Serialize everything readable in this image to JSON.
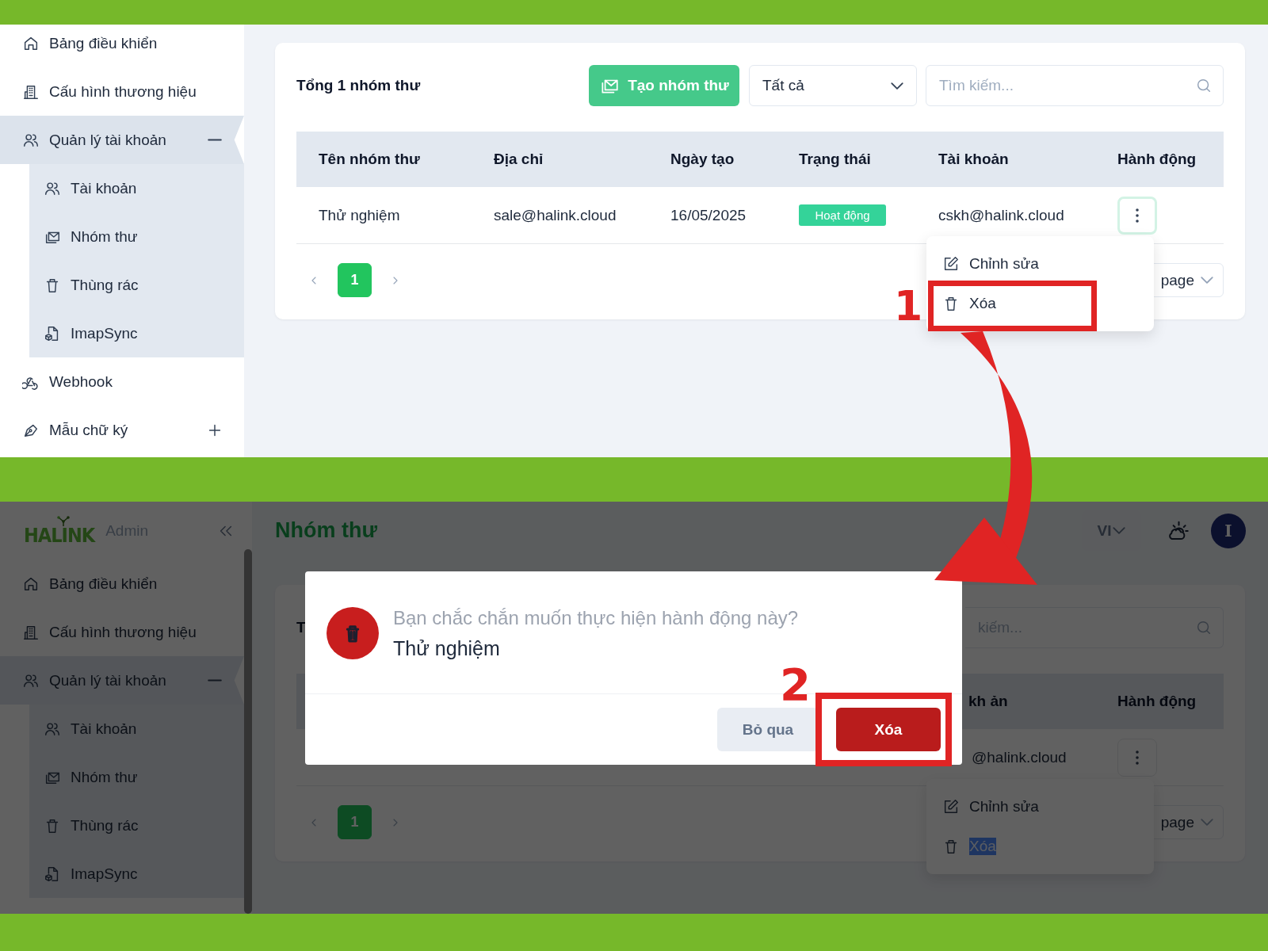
{
  "step_1": {
    "sidebar": [
      {
        "label": "Bảng điều khiển",
        "selected": false
      },
      {
        "label": "Cấu hình thương hiệu",
        "selected": false
      },
      {
        "label": "Quản lý tài khoản",
        "selected": true,
        "expanded": true,
        "children": [
          {
            "label": "Tài khoản"
          },
          {
            "label": "Nhóm thư"
          },
          {
            "label": "Thùng rác"
          },
          {
            "label": "ImapSync"
          }
        ]
      },
      {
        "label": "Webhook",
        "selected": false
      },
      {
        "label": "Mẫu chữ ký",
        "selected": false,
        "expanded": false
      }
    ],
    "list": {
      "total": "Tổng 1 nhóm thư",
      "create_button": "Tạo nhóm thư",
      "filter": "Tất cả",
      "search": {
        "placeholder": "Tìm kiếm..."
      },
      "columns": [
        "Tên nhóm thư",
        "Địa chỉ",
        "Ngày tạo",
        "Trạng thái",
        "Tài khoản",
        "Hành động"
      ],
      "rows": [
        {
          "name": "Thử nghiệm",
          "address": "sale@halink.cloud",
          "created": "16/05/2025",
          "status": "Hoạt động",
          "account": "cskh@halink.cloud",
          "focused": true
        }
      ],
      "pages": [
        {
          "label": "1",
          "selected": true
        }
      ],
      "page_size": "page"
    },
    "action_menu": [
      {
        "label": "Chỉnh sửa",
        "selected": false
      },
      {
        "label": "Xóa",
        "selected": false
      }
    ],
    "callout": {
      "label": "1"
    }
  },
  "step_2": {
    "header": {
      "logo": "HALINK",
      "role": "Admin",
      "title": "Nhóm thư",
      "language": "VI",
      "avatar": "I"
    },
    "sidebar": [
      {
        "label": "Bảng điều khiển",
        "selected": false
      },
      {
        "label": "Cấu hình thương hiệu",
        "selected": false
      },
      {
        "label": "Quản lý tài khoản",
        "selected": true,
        "expanded": true,
        "children": [
          {
            "label": "Tài khoản"
          },
          {
            "label": "Nhóm thư"
          },
          {
            "label": "Thùng rác"
          },
          {
            "label": "ImapSync"
          }
        ]
      }
    ],
    "list": {
      "total": "T",
      "search": {
        "placeholder": "kiếm..."
      },
      "columns": [
        "kh ản",
        "Hành động"
      ],
      "rows": [
        {
          "account": "@halink.cloud",
          "focused": false
        }
      ],
      "pages": [
        {
          "label": "1",
          "selected": true
        }
      ],
      "page_size": "page"
    },
    "action_menu": [
      {
        "label": "Chỉnh sửa",
        "selected": false
      },
      {
        "label": "Xóa",
        "selected": true
      }
    ],
    "dialog": {
      "message": "Bạn chắc chắn muốn thực hiện hành động này?",
      "subject": "Thử nghiệm",
      "buttons": [
        {
          "label": "Bỏ qua",
          "kind": "cancel"
        },
        {
          "label": "Xóa",
          "kind": "danger"
        }
      ]
    },
    "callout": {
      "label": "2"
    }
  }
}
